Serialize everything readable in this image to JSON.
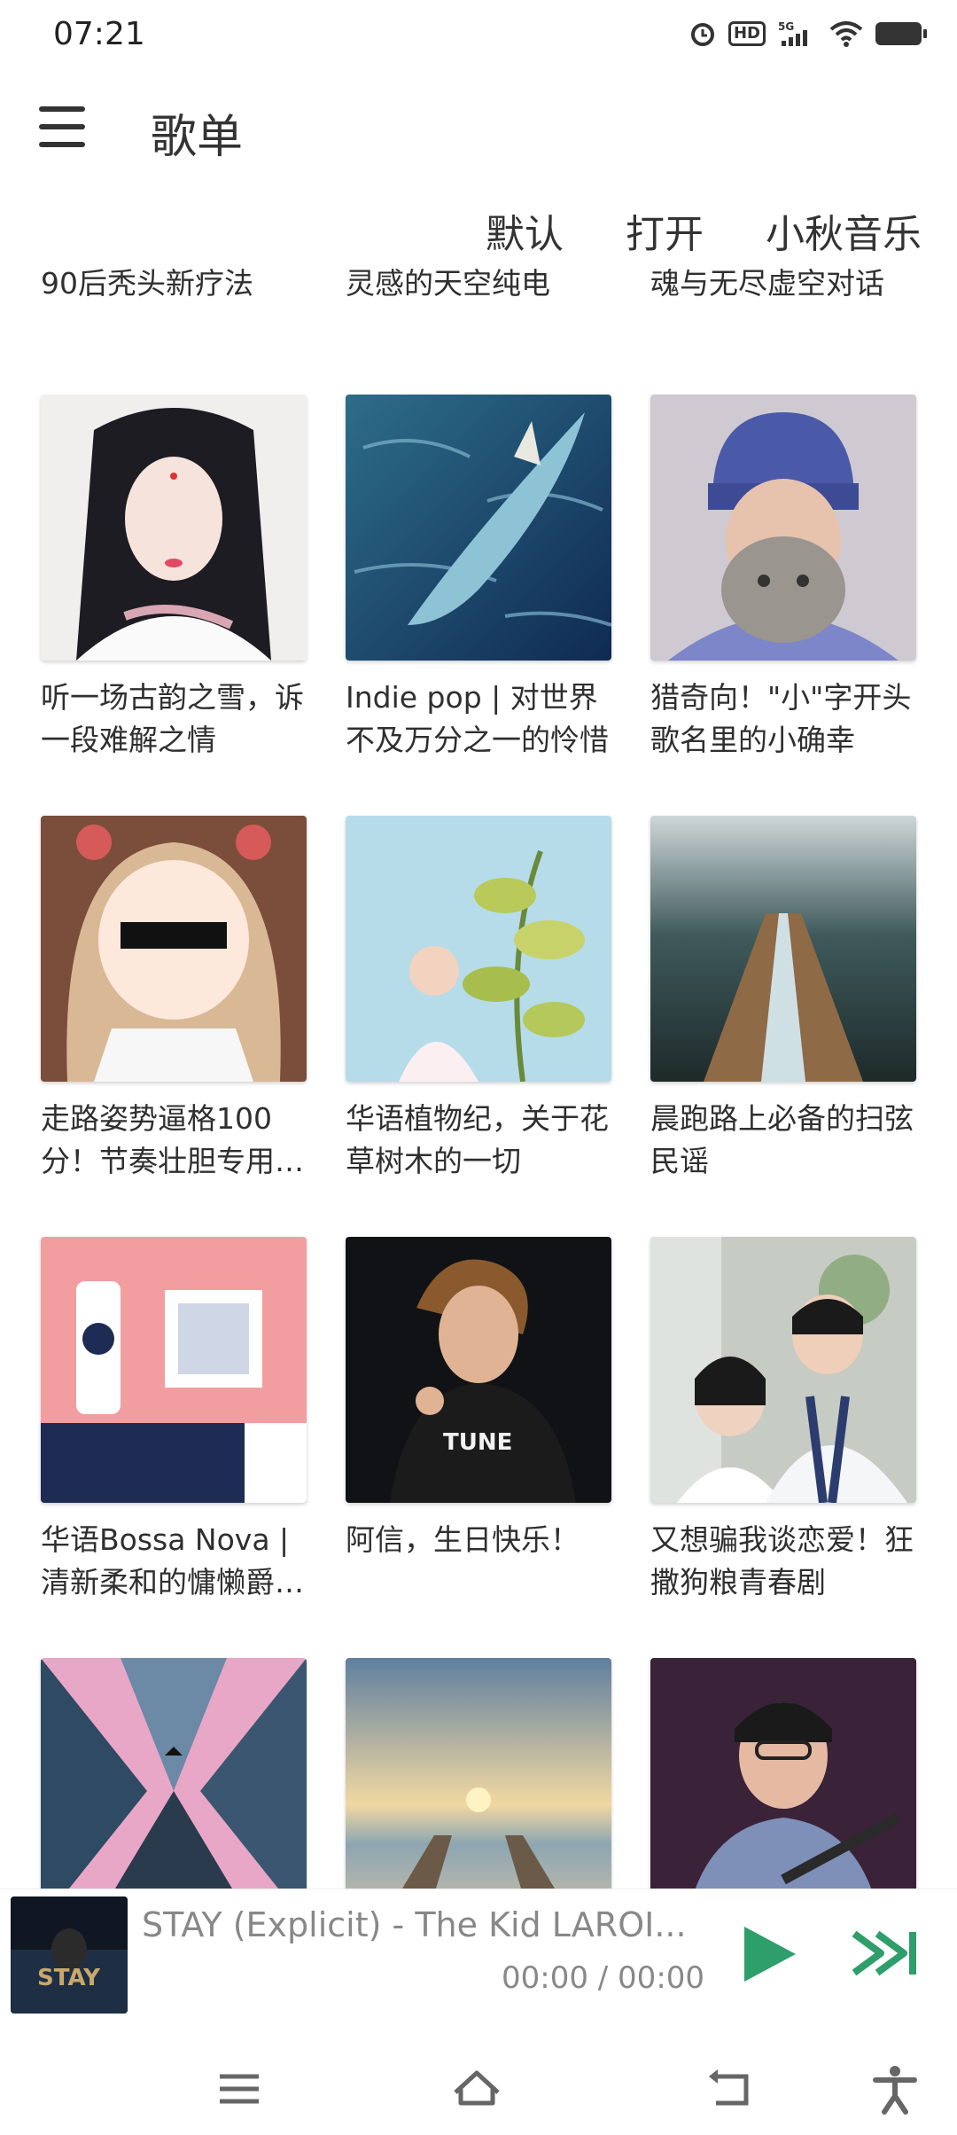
{
  "status_bar": {
    "time": "07:21",
    "icons": [
      "alarm-icon",
      "hd-icon",
      "5g-signal-icon",
      "wifi-icon",
      "battery-icon"
    ],
    "hd_label": "HD",
    "net_label": "5G"
  },
  "appbar": {
    "title": "歌单"
  },
  "actions": {
    "default_label": "默认",
    "open_label": "打开",
    "app_label": "小秋音乐"
  },
  "partial_row": [
    {
      "caption": "90后秃头新疗法"
    },
    {
      "caption": "灵感的天空纯电"
    },
    {
      "caption": "魂与无尽虚空对话"
    }
  ],
  "playlists": [
    {
      "caption": "听一场古韵之雪，诉一段难解之情",
      "cover": "portrait-girl"
    },
    {
      "caption": "Indie pop | 对世界不及万分之一的怜惜",
      "cover": "whale-ocean"
    },
    {
      "caption": "猎奇向！\"小\"字开头歌名里的小确幸",
      "cover": "girl-cat"
    },
    {
      "caption": "走路姿势逼格100分！节奏壮胆专用…",
      "cover": "anime-sunglasses"
    },
    {
      "caption": "华语植物纪，关于花草树木的一切",
      "cover": "plant-illustration"
    },
    {
      "caption": "晨跑路上必备的扫弦民谣",
      "cover": "forest-road"
    },
    {
      "caption": "华语Bossa Nova | 清新柔和的慵懒爵…",
      "cover": "pink-room"
    },
    {
      "caption": "阿信，生日快乐！",
      "cover": "singer-stage"
    },
    {
      "caption": "又想骗我谈恋爱！狂撒狗粮青春剧",
      "cover": "school-couple"
    },
    {
      "caption": "",
      "cover": "city-skyscrapers"
    },
    {
      "caption": "",
      "cover": "beach-sunset"
    },
    {
      "caption": "",
      "cover": "guitar-singer"
    }
  ],
  "player": {
    "song": "STAY (Explicit) - The Kid LAROI...",
    "timer": "00:00 / 00:00",
    "thumb_text": "STAY",
    "accent": "#2e9e6b"
  },
  "navbar": {
    "icons": [
      "menu-nav-icon",
      "home-nav-icon",
      "back-nav-icon",
      "accessibility-icon"
    ]
  }
}
